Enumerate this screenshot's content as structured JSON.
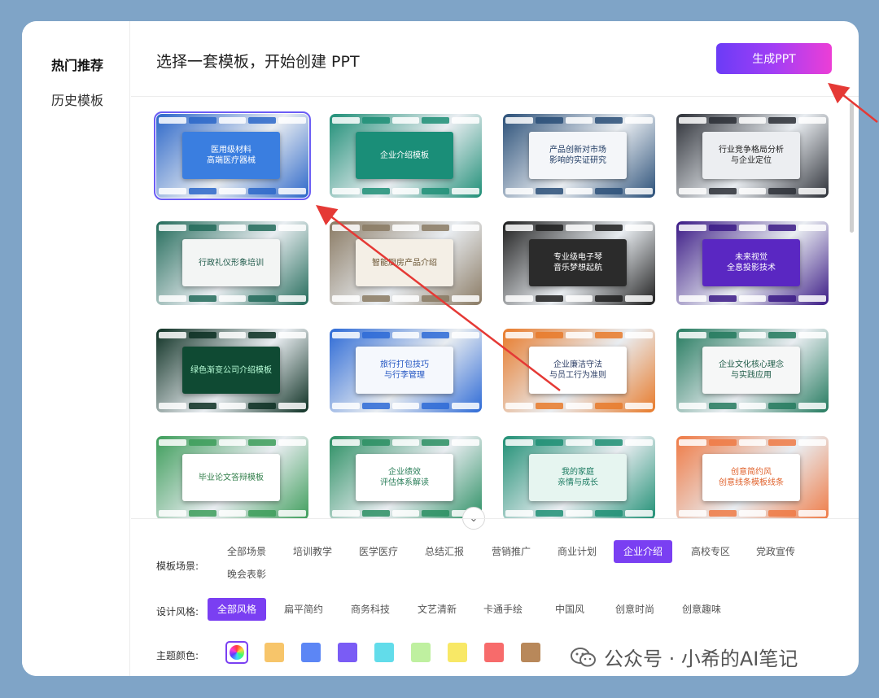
{
  "sidebar": {
    "items": [
      {
        "label": "热门推荐",
        "active": true
      },
      {
        "label": "历史模板",
        "active": false
      }
    ]
  },
  "header": {
    "title": "选择一套模板，开始创建 PPT",
    "generate_label": "生成PPT"
  },
  "templates": [
    {
      "title": "医用级材料\n高端医疗器械",
      "theme": "#2c67c9",
      "card": "#3a7ee0",
      "text": "#ffffff",
      "selected": true
    },
    {
      "title": "企业介绍模板",
      "theme": "#1f8f77",
      "card": "#1a8e78",
      "text": "#ffffff"
    },
    {
      "title": "产品创新对市场\n影响的实证研究",
      "theme": "#2a4f78",
      "card": "#f4f6f9",
      "text": "#1f3b63"
    },
    {
      "title": "行业竞争格局分析\n与企业定位",
      "theme": "#2c2f36",
      "card": "#eceef1",
      "text": "#222222"
    },
    {
      "title": "行政礼仪形象培训",
      "theme": "#236b5a",
      "card": "#f3f5f4",
      "text": "#1f5a4a"
    },
    {
      "title": "智能厨房产品介绍",
      "theme": "#8a7a63",
      "card": "#f4efe6",
      "text": "#6b5635"
    },
    {
      "title": "专业级电子琴\n音乐梦想起航",
      "theme": "#1e1e1e",
      "card": "#2b2b2b",
      "text": "#ffffff"
    },
    {
      "title": "未来视觉\n全息投影技术",
      "theme": "#3b1a86",
      "card": "#5a27c2",
      "text": "#ffffff"
    },
    {
      "title": "绿色渐变公司介绍模板",
      "theme": "#0c2f22",
      "card": "#0f4a33",
      "text": "#b9ffd9"
    },
    {
      "title": "旅行打包技巧\n与行李管理",
      "theme": "#2d6ad6",
      "card": "#f5f8fd",
      "text": "#2255c2"
    },
    {
      "title": "企业廉洁守法\n与员工行为准则",
      "theme": "#e87a2a",
      "card": "#ffffff",
      "text": "#2c3e66"
    },
    {
      "title": "企业文化核心理念\n与实践应用",
      "theme": "#247a5e",
      "card": "#f6f7f7",
      "text": "#1f5c48"
    },
    {
      "title": "毕业论文答辩模板",
      "theme": "#3d9d5a",
      "card": "#ffffff",
      "text": "#2f7d48"
    },
    {
      "title": "企业绩效\n评估体系解读",
      "theme": "#2b8f63",
      "card": "#ffffff",
      "text": "#2b7f5a"
    },
    {
      "title": "我的家庭\n亲情与成长",
      "theme": "#1f8f74",
      "card": "#e6f5f0",
      "text": "#1a7a60"
    },
    {
      "title": "创意简约风\n创意线条模板线条",
      "theme": "#ef7a45",
      "card": "#ffffff",
      "text": "#e0622c"
    }
  ],
  "filters": {
    "scene_label": "模板场景:",
    "scene_options": [
      "全部场景",
      "培训教学",
      "医学医疗",
      "总结汇报",
      "营销推广",
      "商业计划",
      "企业介绍",
      "高校专区",
      "党政宣传",
      "晚会表彰"
    ],
    "scene_selected": "企业介绍",
    "style_label": "设计风格:",
    "style_options": [
      "全部风格",
      "扁平简约",
      "商务科技",
      "文艺清新",
      "卡通手绘",
      "中国风",
      "创意时尚",
      "创意趣味"
    ],
    "style_selected": "全部风格",
    "color_label": "主题颜色:",
    "colors": [
      "#f7c56a",
      "#5c86f5",
      "#7a5cf5",
      "#62dcea",
      "#bff0a0",
      "#f8e866",
      "#f76b6b",
      "#b8885a"
    ]
  },
  "watermark": "公众号 · 小希的AI笔记",
  "icons": {
    "expand": "chevron-down-icon",
    "all_colors": "rainbow-icon",
    "wechat": "wechat-icon"
  },
  "colors": {
    "accent": "#7a3ff2",
    "button_gradient_start": "#6b3cf6",
    "button_gradient_end": "#ec3ed6",
    "background": "#7fa4c7",
    "annotation_arrow": "#e53935"
  }
}
